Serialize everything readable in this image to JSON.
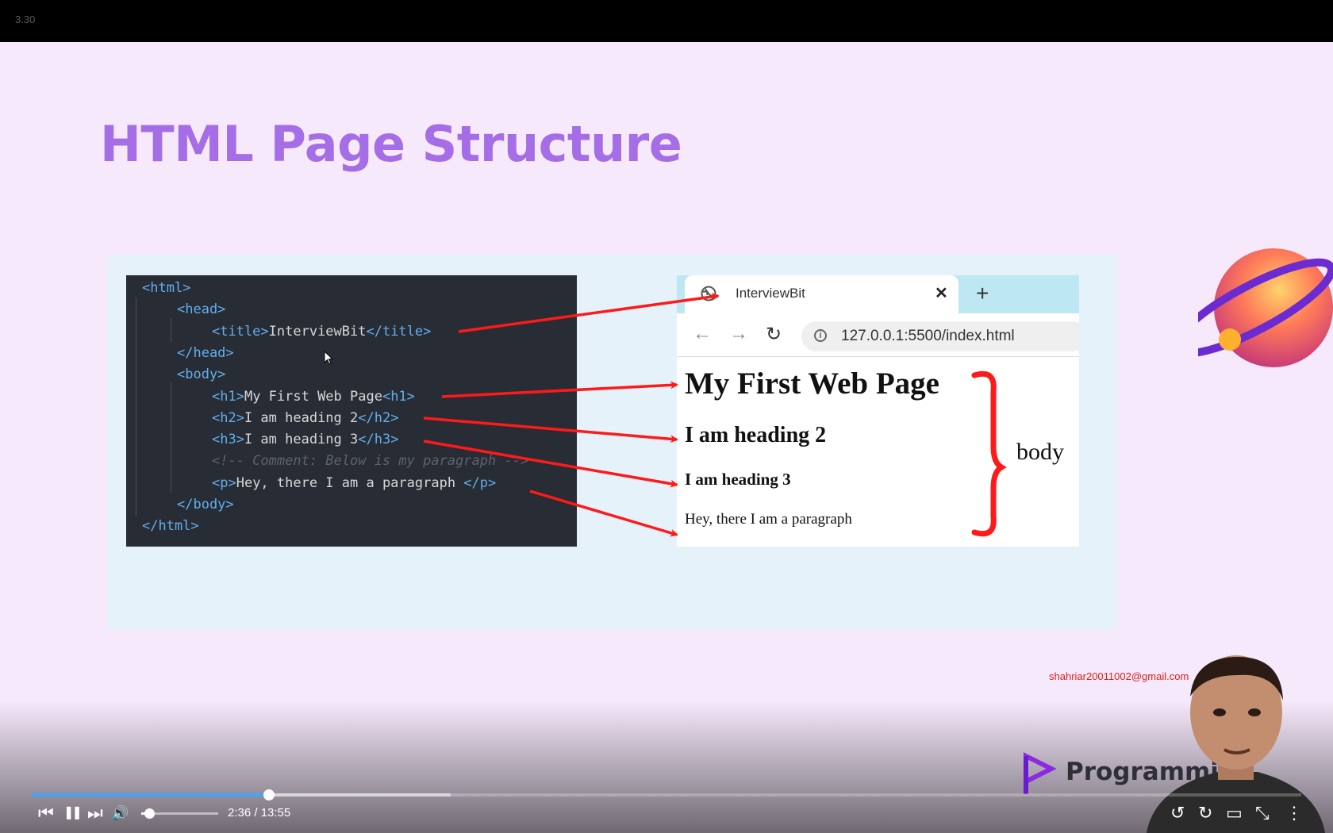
{
  "topbar": {
    "version": "3.30"
  },
  "slide": {
    "title": "HTML Page Structure",
    "code_lines": [
      {
        "parts": [
          {
            "cls": "tag",
            "text": "<html>"
          }
        ]
      },
      {
        "parts": [
          {
            "cls": "tag",
            "text": "<head>"
          }
        ]
      },
      {
        "parts": [
          {
            "cls": "tag",
            "text": "<title>"
          },
          {
            "cls": "",
            "text": "InterviewBit"
          },
          {
            "cls": "tag",
            "text": "</title>"
          }
        ]
      },
      {
        "parts": [
          {
            "cls": "tag",
            "text": "</head>"
          }
        ]
      },
      {
        "parts": [
          {
            "cls": "tag",
            "text": "<body>"
          }
        ]
      },
      {
        "parts": [
          {
            "cls": "tag",
            "text": "<h1>"
          },
          {
            "cls": "",
            "text": "My First Web Page"
          },
          {
            "cls": "tag",
            "text": "<h1>"
          }
        ]
      },
      {
        "parts": [
          {
            "cls": "tag",
            "text": "<h2>"
          },
          {
            "cls": "",
            "text": "I am heading 2"
          },
          {
            "cls": "tag",
            "text": "</h2>"
          }
        ]
      },
      {
        "parts": [
          {
            "cls": "tag",
            "text": "<h3>"
          },
          {
            "cls": "",
            "text": "I am heading 3"
          },
          {
            "cls": "tag",
            "text": "</h3>"
          }
        ]
      },
      {
        "parts": [
          {
            "cls": "cmt",
            "text": "<!-- Comment: Below is my paragraph -->"
          }
        ]
      },
      {
        "parts": [
          {
            "cls": "tag",
            "text": "<p>"
          },
          {
            "cls": "",
            "text": "Hey, there I am a paragraph "
          },
          {
            "cls": "tag",
            "text": "</p>"
          }
        ]
      },
      {
        "parts": [
          {
            "cls": "tag",
            "text": "</body>"
          }
        ]
      },
      {
        "parts": [
          {
            "cls": "tag",
            "text": "</html>"
          }
        ]
      }
    ],
    "browser": {
      "tab_title": "InterviewBit",
      "tab_close": "✕",
      "new_tab": "+",
      "back": "←",
      "forward": "→",
      "reload": "↻",
      "info": "i",
      "url": "127.0.0.1:5500/index.html",
      "h1": "My First Web Page",
      "h2": "I am heading 2",
      "h3": "I am heading 3",
      "p": "Hey, there I am a paragraph"
    },
    "body_label": "body"
  },
  "overlay": {
    "email": "shahriar20011002@gmail.com",
    "brand": "Programmin"
  },
  "player": {
    "current_time": "2:36",
    "duration": "13:55",
    "time_display": "2:36 / 13:55",
    "progress": 0.187,
    "buffered": 0.33,
    "volume": 0.1,
    "icons": {
      "prev": "⏮",
      "pause": "❚❚",
      "next": "⏭",
      "volume": "🔊",
      "rewind": "↺",
      "forward": "↻",
      "theater": "▭",
      "exit_fullscreen": "⤡",
      "more": "⋮"
    },
    "colors": {
      "played": "#3ea6ff"
    }
  }
}
